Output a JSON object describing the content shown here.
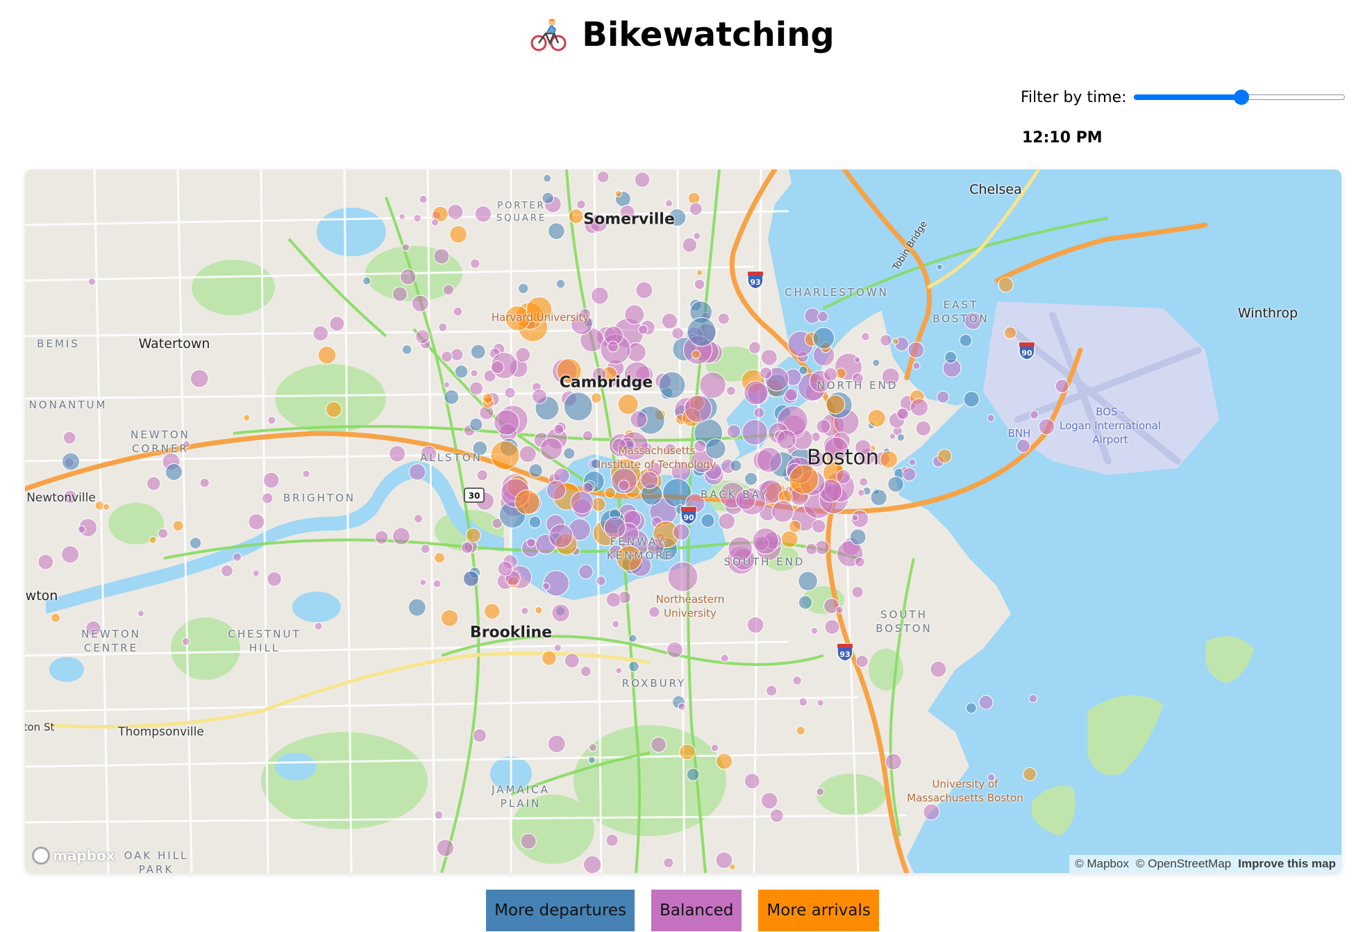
{
  "header": {
    "title": "Bikewatching",
    "icon": "person-biking-icon"
  },
  "filter": {
    "label": "Filter by time:",
    "time_display": "12:10 PM",
    "slider_fraction": 0.51
  },
  "map": {
    "labels": {
      "somerville": "Somerville",
      "chelsea": "Chelsea",
      "charlestown": "CHARLESTOWN",
      "east_boston": "EAST\nBOSTON",
      "winthrop": "Winthrop",
      "bemis": "BEMIS",
      "watertown": "Watertown",
      "harvard": "Harvard University",
      "cambridge": "Cambridge",
      "north_end": "NORTH END",
      "nonantum": "NONANTUM",
      "newton_corner": "NEWTON\nCORNER",
      "allston": "ALLSTON",
      "mit": "Massachusetts\nInstitute of Technology",
      "boston": "Boston",
      "airport": "BOS -\nLogan International\nAirport",
      "bnh": "BNH",
      "newtonville": "Newtonville",
      "brighton": "BRIGHTON",
      "back_bay": "BACK BAY",
      "fenway": "FENWAY-\nKENMORE",
      "south_end": "SOUTH END",
      "newton_edge": "wton",
      "northeastern": "Northeastern\nUniversity",
      "south_boston": "SOUTH\nBOSTON",
      "newton_centre": "NEWTON\nCENTRE",
      "chestnut_hill": "CHESTNUT\nHILL",
      "brookline": "Brookline",
      "roxbury": "ROXBURY",
      "ton_st": "ton St",
      "thompsonville": "Thompsonville",
      "umass": "University of\nMassachusetts Boston",
      "jamaica_plain": "JAMAICA\nPLAIN",
      "oak_hill": "OAK HILL\nPARK",
      "porter_square": "PORTER\nSQUARE",
      "tobin_bridge": "Tobin Bridge"
    },
    "shields": {
      "i93_north": "93",
      "i93_south": "93",
      "i90_east": "90",
      "i90_west": "90",
      "rt30": "30"
    },
    "logo": "mapbox",
    "attribution": {
      "mapbox": "© Mapbox",
      "osm": "© OpenStreetMap",
      "improve": "Improve this map"
    }
  },
  "legend": [
    {
      "label": "More departures",
      "color": "#4682b4"
    },
    {
      "label": "Balanced",
      "color": "#c471c0"
    },
    {
      "label": "More arrivals",
      "color": "#ff8c00"
    }
  ],
  "colors": {
    "departures": "#4682b4",
    "balanced": "#c471c0",
    "arrivals": "#ff8c00",
    "water": "#9fd7f5",
    "park": "#b9e3a8",
    "bike_lane": "#7ed957",
    "highway": "#f7a245",
    "slider_accent": "#0075ff"
  }
}
